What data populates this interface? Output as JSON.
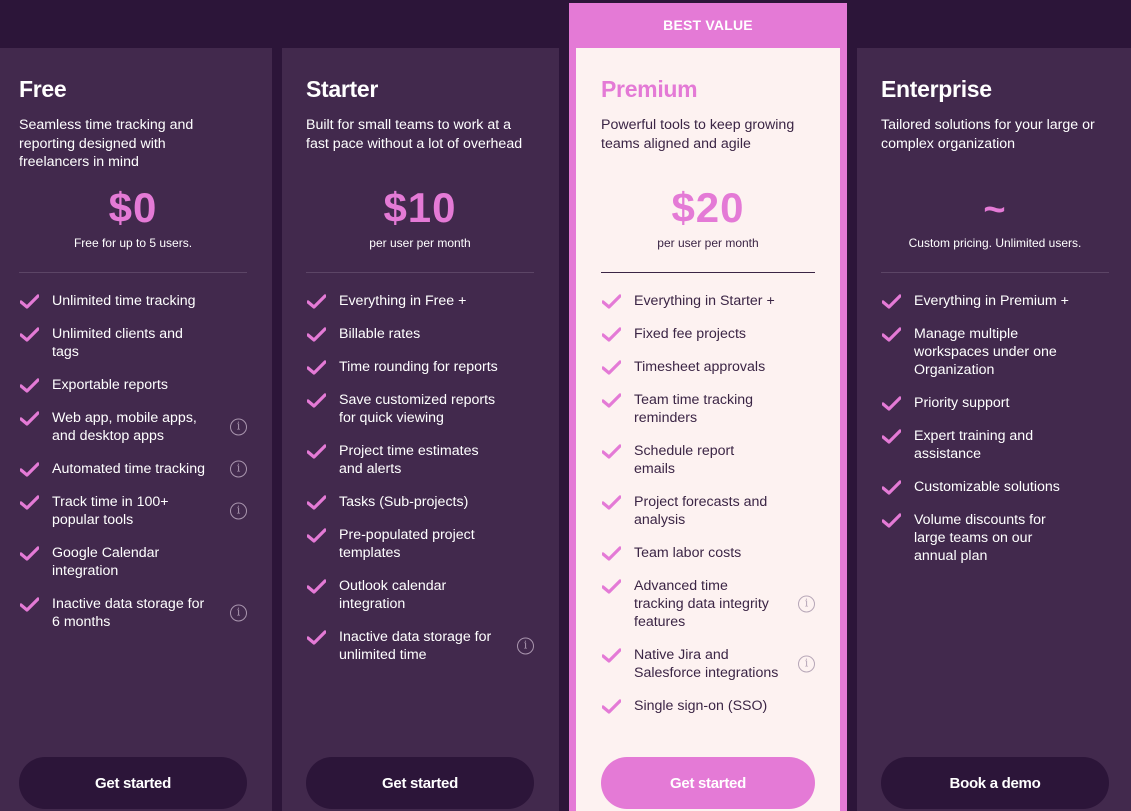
{
  "colors": {
    "page_bg": "#2c1539",
    "card_bg": "#42294d",
    "accent": "#e47ad6",
    "premium_bg": "#fdf2f1",
    "premium_text": "#3b2545"
  },
  "plans": [
    {
      "title": "Free",
      "description": "Seamless time tracking and reporting designed with freelancers in mind",
      "price": "$0",
      "price_note": "Free for up to 5 users.",
      "cta": "Get started",
      "features": [
        {
          "label": "Unlimited time tracking",
          "info": false
        },
        {
          "label": "Unlimited clients and tags",
          "info": false
        },
        {
          "label": "Exportable reports",
          "info": false
        },
        {
          "label": "Web app, mobile apps, and desktop apps",
          "info": true
        },
        {
          "label": "Automated time tracking",
          "info": true
        },
        {
          "label": "Track time in 100+ popular tools",
          "info": true
        },
        {
          "label": "Google Calendar integration",
          "info": false
        },
        {
          "label": "Inactive data storage for 6 months",
          "info": true
        }
      ]
    },
    {
      "title": "Starter",
      "description": "Built for small teams to work at a fast pace without a lot of overhead",
      "price": "$10",
      "price_note": "per user per month",
      "cta": "Get started",
      "features": [
        {
          "label": "Everything in Free +",
          "info": false
        },
        {
          "label": "Billable rates",
          "info": false
        },
        {
          "label": "Time rounding for reports",
          "info": false
        },
        {
          "label": "Save customized reports for quick viewing",
          "info": false
        },
        {
          "label": "Project time estimates and alerts",
          "info": false
        },
        {
          "label": "Tasks (Sub-projects)",
          "info": false
        },
        {
          "label": "Pre-populated project templates",
          "info": false
        },
        {
          "label": "Outlook calendar integration",
          "info": false
        },
        {
          "label": "Inactive data storage for unlimited time",
          "info": true
        }
      ]
    },
    {
      "badge": "BEST VALUE",
      "title": "Premium",
      "description": "Powerful tools to keep growing teams aligned and agile",
      "price": "$20",
      "price_note": "per user per month",
      "cta": "Get started",
      "features": [
        {
          "label": "Everything in Starter +",
          "info": false
        },
        {
          "label": "Fixed fee projects",
          "info": false
        },
        {
          "label": "Timesheet approvals",
          "info": false
        },
        {
          "label": "Team time tracking reminders",
          "info": false
        },
        {
          "label": "Schedule report emails",
          "info": false
        },
        {
          "label": "Project forecasts and analysis",
          "info": false
        },
        {
          "label": "Team labor costs",
          "info": false
        },
        {
          "label": "Advanced time tracking data integrity features",
          "info": true
        },
        {
          "label": "Native Jira and Salesforce integrations",
          "info": true
        },
        {
          "label": "Single sign-on (SSO)",
          "info": false
        }
      ]
    },
    {
      "title": "Enterprise",
      "description": "Tailored solutions for your large or complex organization",
      "price": "~",
      "price_note": "Custom pricing. Unlimited users.",
      "cta": "Book a demo",
      "features": [
        {
          "label": "Everything in Premium +",
          "info": false
        },
        {
          "label": "Manage multiple workspaces under one Organization",
          "info": false
        },
        {
          "label": "Priority support",
          "info": false
        },
        {
          "label": "Expert training and assistance",
          "info": false
        },
        {
          "label": "Customizable solutions",
          "info": false
        },
        {
          "label": "Volume discounts for large teams on our annual plan",
          "info": false
        }
      ]
    }
  ],
  "icons": {
    "check": "check-icon",
    "info": "info-icon"
  }
}
